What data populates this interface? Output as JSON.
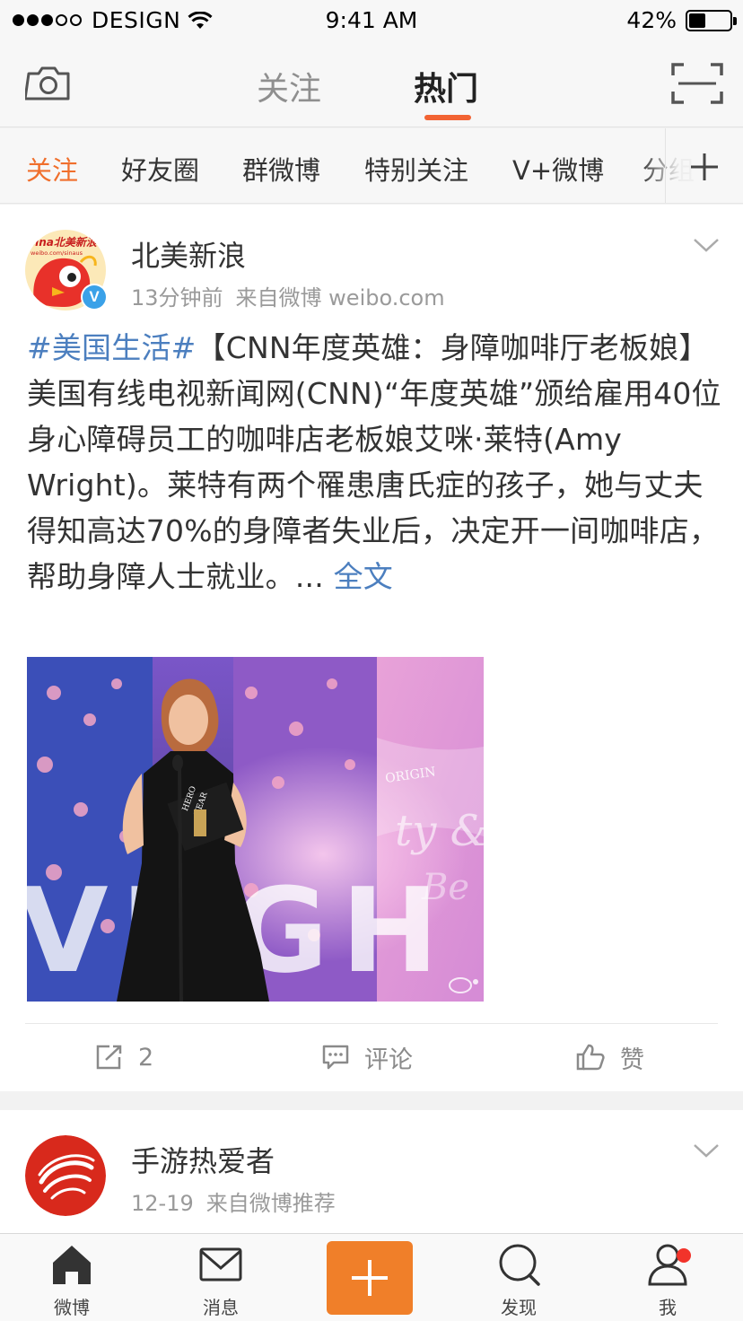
{
  "status_bar": {
    "carrier": "DESIGN",
    "time": "9:41 AM",
    "battery": "42%",
    "battery_level": 0.42,
    "signal_bars_filled": 3,
    "signal_bars_total": 5
  },
  "top_nav": {
    "tabs": [
      {
        "label": "关注",
        "active": false
      },
      {
        "label": "热门",
        "active": true
      }
    ],
    "left_icon": "camera-icon",
    "right_icon": "scan-icon"
  },
  "group_bar": {
    "items": [
      {
        "label": "关注",
        "active": true
      },
      {
        "label": "好友圈"
      },
      {
        "label": "群微博"
      },
      {
        "label": "特别关注"
      },
      {
        "label": "V+微博"
      },
      {
        "label": "分组"
      }
    ],
    "add_icon": "plus-icon"
  },
  "posts": [
    {
      "user": "北美新浪",
      "avatar_text": "sina北美新浪",
      "avatar_subtext": "weibo.com/sinaus",
      "verified_badge": "V",
      "time": "13分钟前",
      "source": "来自微博 weibo.com",
      "hashtag": "#美国生活#",
      "text": "【CNN年度英雄：身障咖啡厅老板娘】美国有线电视新闻网(CNN)“年度英雄”颁给雇用40位身心障碍员工的咖啡店老板娘艾咪·莱特(Amy Wright)。莱特有两个罹患唐氏症的孩子，她与丈夫得知高达70%的身障者失业后，决定开一间咖啡店，帮助身障人士就业。",
      "ellipsis": "...",
      "more_link": "全文",
      "image": {
        "big_letters": "VIIGH",
        "award_text_1": "HERO",
        "award_text_2": "YEAR",
        "banner_text": "ORIGIN",
        "script_text": "ty &",
        "script_text_2": "Be"
      },
      "repost_count": "2",
      "comment_label": "评论",
      "like_label": "赞"
    },
    {
      "user": "手游热爱者",
      "time": "12-19",
      "source": "来自微博推荐"
    }
  ],
  "tab_bar": {
    "tabs": [
      {
        "label": "微博",
        "icon": "home-icon"
      },
      {
        "label": "消息",
        "icon": "message-icon"
      },
      {
        "label": "发现",
        "icon": "discover-icon"
      },
      {
        "label": "我",
        "icon": "profile-icon"
      }
    ],
    "compose_icon": "compose-plus-icon"
  },
  "colors": {
    "accent": "#f07f29",
    "hot_underline": "#f26333",
    "link": "#4c7fbf",
    "verified": "#3aa1e8",
    "notification": "#f2332a"
  }
}
